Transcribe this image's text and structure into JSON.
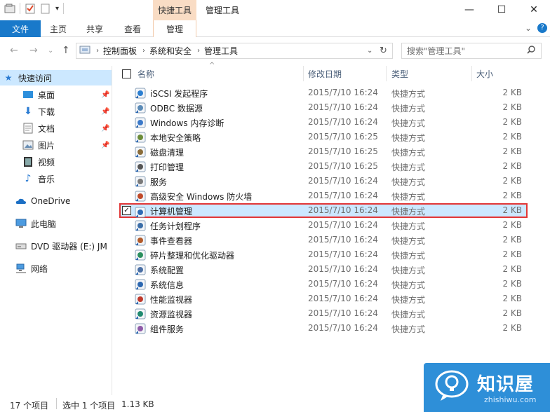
{
  "titlebar": {
    "context_tab_header": "快捷工具",
    "window_title": "管理工具",
    "qat_dropdown": "▾",
    "minimize": "—",
    "maximize": "☐",
    "close": "✕"
  },
  "ribbon": {
    "tabs": [
      "文件",
      "主页",
      "共享",
      "查看",
      "管理"
    ],
    "collapse": "⌄",
    "help": "?"
  },
  "address": {
    "crumbs": [
      "控制面板",
      "系统和安全",
      "管理工具"
    ],
    "search_placeholder": "搜索\"管理工具\""
  },
  "sidebar": {
    "items": [
      {
        "label": "快速访问",
        "icon": "star-icon"
      },
      {
        "label": "桌面",
        "icon": "desktop-icon",
        "pinned": true
      },
      {
        "label": "下载",
        "icon": "download-icon",
        "pinned": true
      },
      {
        "label": "文档",
        "icon": "document-icon",
        "pinned": true
      },
      {
        "label": "图片",
        "icon": "picture-icon",
        "pinned": true
      },
      {
        "label": "视频",
        "icon": "video-icon"
      },
      {
        "label": "音乐",
        "icon": "music-icon"
      },
      {
        "label": "OneDrive",
        "icon": "cloud-icon"
      },
      {
        "label": "此电脑",
        "icon": "computer-icon"
      },
      {
        "label": "DVD 驱动器 (E:) JM",
        "icon": "dvd-icon"
      },
      {
        "label": "网络",
        "icon": "network-icon"
      }
    ]
  },
  "columns": {
    "name": "名称",
    "modified": "修改日期",
    "type": "类型",
    "size": "大小"
  },
  "files": [
    {
      "name": "iSCSI 发起程序",
      "modified": "2015/7/10 16:24",
      "type": "快捷方式",
      "size": "2 KB"
    },
    {
      "name": "ODBC 数据源",
      "modified": "2015/7/10 16:24",
      "type": "快捷方式",
      "size": "2 KB"
    },
    {
      "name": "Windows 内存诊断",
      "modified": "2015/7/10 16:24",
      "type": "快捷方式",
      "size": "2 KB"
    },
    {
      "name": "本地安全策略",
      "modified": "2015/7/10 16:25",
      "type": "快捷方式",
      "size": "2 KB"
    },
    {
      "name": "磁盘清理",
      "modified": "2015/7/10 16:25",
      "type": "快捷方式",
      "size": "2 KB"
    },
    {
      "name": "打印管理",
      "modified": "2015/7/10 16:25",
      "type": "快捷方式",
      "size": "2 KB"
    },
    {
      "name": "服务",
      "modified": "2015/7/10 16:24",
      "type": "快捷方式",
      "size": "2 KB"
    },
    {
      "name": "高级安全 Windows 防火墙",
      "modified": "2015/7/10 16:24",
      "type": "快捷方式",
      "size": "2 KB"
    },
    {
      "name": "计算机管理",
      "modified": "2015/7/10 16:24",
      "type": "快捷方式",
      "size": "2 KB",
      "selected": true
    },
    {
      "name": "任务计划程序",
      "modified": "2015/7/10 16:24",
      "type": "快捷方式",
      "size": "2 KB"
    },
    {
      "name": "事件查看器",
      "modified": "2015/7/10 16:24",
      "type": "快捷方式",
      "size": "2 KB"
    },
    {
      "name": "碎片整理和优化驱动器",
      "modified": "2015/7/10 16:24",
      "type": "快捷方式",
      "size": "2 KB"
    },
    {
      "name": "系统配置",
      "modified": "2015/7/10 16:24",
      "type": "快捷方式",
      "size": "2 KB"
    },
    {
      "name": "系统信息",
      "modified": "2015/7/10 16:24",
      "type": "快捷方式",
      "size": "2 KB"
    },
    {
      "name": "性能监视器",
      "modified": "2015/7/10 16:24",
      "type": "快捷方式",
      "size": "2 KB"
    },
    {
      "name": "资源监视器",
      "modified": "2015/7/10 16:24",
      "type": "快捷方式",
      "size": "2 KB"
    },
    {
      "name": "组件服务",
      "modified": "2015/7/10 16:24",
      "type": "快捷方式",
      "size": "2 KB"
    }
  ],
  "status": {
    "count": "17 个项目",
    "selection": "选中 1 个项目",
    "selection_size": "1.13 KB"
  },
  "watermark": {
    "title": "知识屋",
    "subtitle": "zhishiwu.com"
  },
  "colors": {
    "accent": "#1979ca",
    "selection": "#cce8ff",
    "highlight_border": "#e23636",
    "context_tab": "#f9dcc4"
  }
}
